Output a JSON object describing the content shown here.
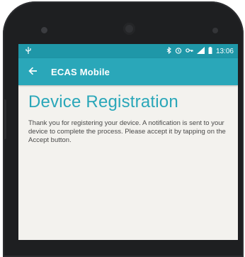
{
  "status_bar": {
    "time": "13:06",
    "left_icon": "usb-icon",
    "right_icons": [
      "bluetooth-icon",
      "alarm-icon",
      "vpn-key-icon",
      "signal-icon",
      "battery-icon"
    ]
  },
  "app_bar": {
    "back_icon": "arrow-left-icon",
    "title": "ECAS Mobile"
  },
  "content": {
    "heading": "Device Registration",
    "message": "Thank you for registering your device. A notification is sent to your device to complete the process. Please accept it by tapping on the Accept button."
  },
  "colors": {
    "status_bar": "#1f97a8",
    "app_bar": "#2aa7b9",
    "heading": "#2aa7b9",
    "screen_background": "#f3f2ee",
    "device_body": "#1e1f21"
  }
}
